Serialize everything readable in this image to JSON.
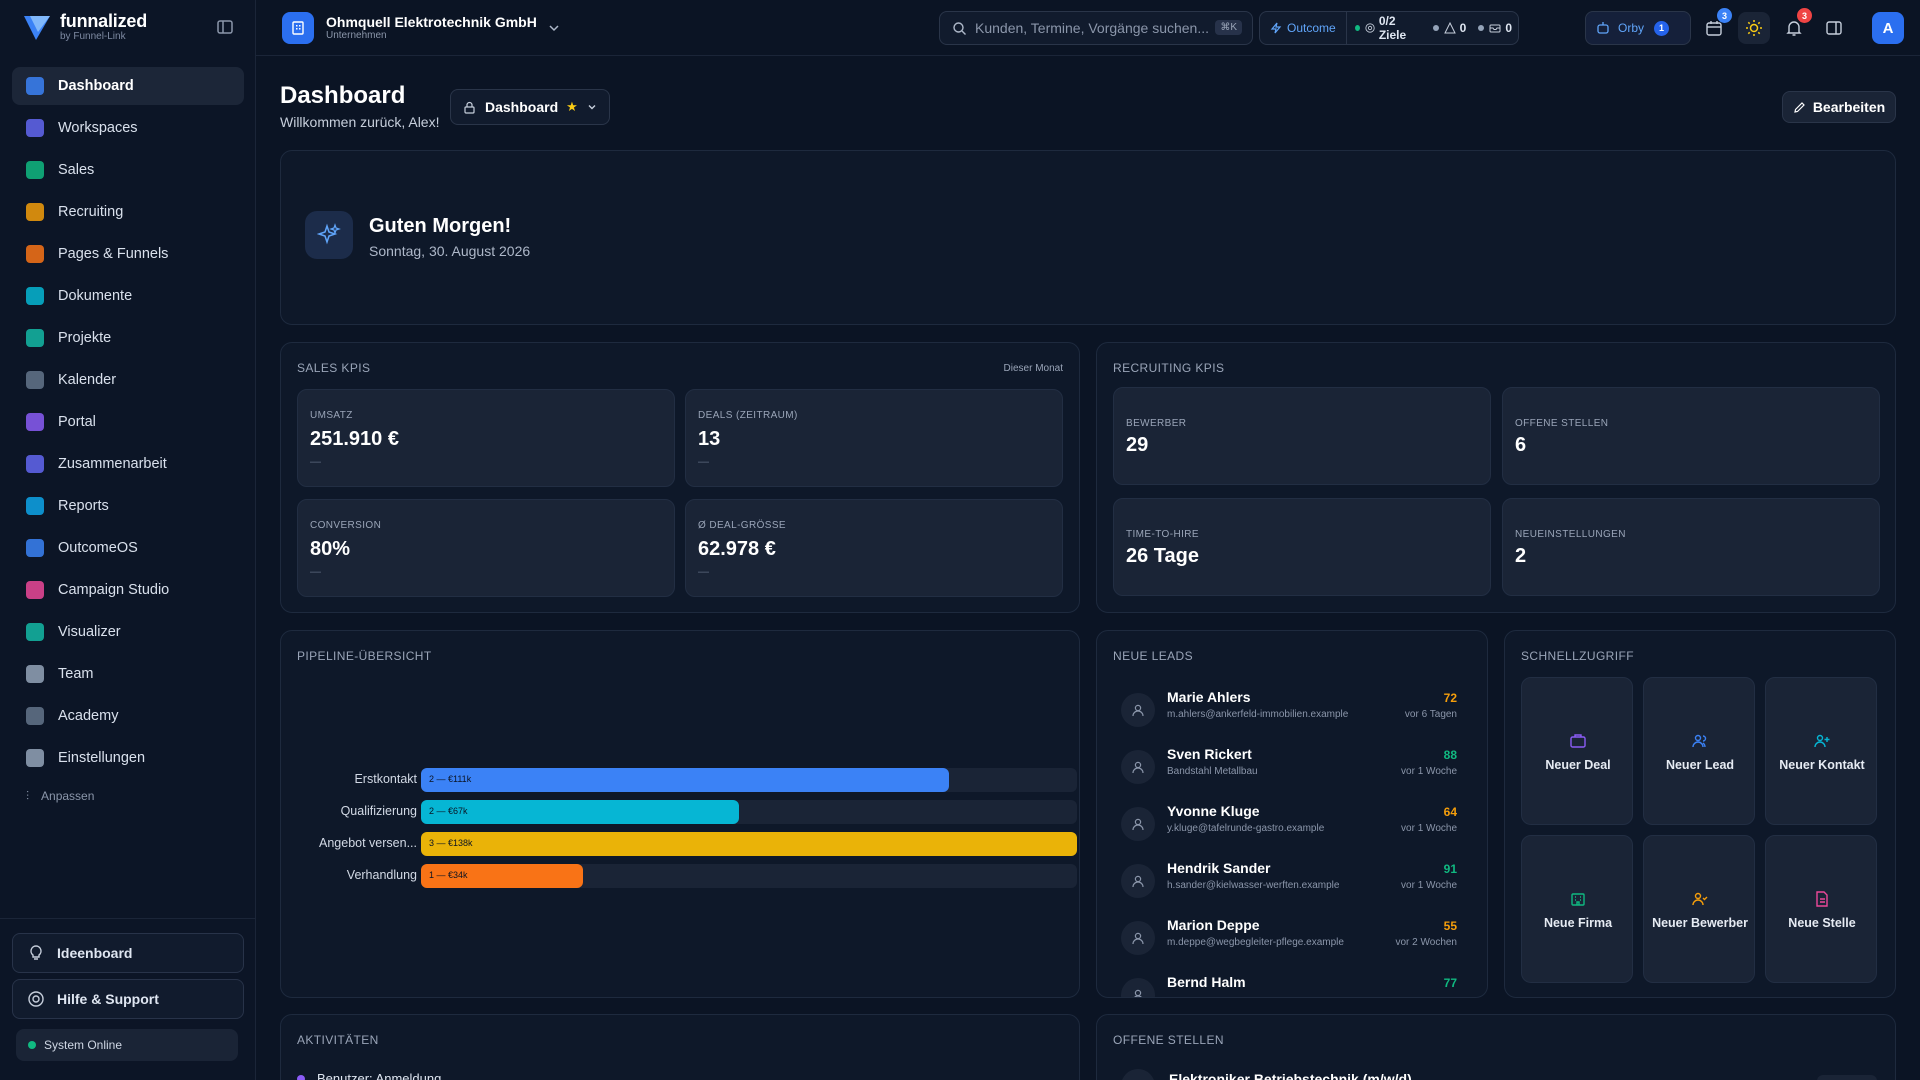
{
  "logo": {
    "name": "funnalized",
    "sub": "by Funnel-Link"
  },
  "sidebar": {
    "items": [
      {
        "label": "Dashboard",
        "color": "#3b82f6",
        "active": true
      },
      {
        "label": "Workspaces",
        "color": "#6366f1"
      },
      {
        "label": "Sales",
        "color": "#10b981"
      },
      {
        "label": "Recruiting",
        "color": "#f59e0b"
      },
      {
        "label": "Pages & Funnels",
        "color": "#f97316"
      },
      {
        "label": "Dokumente",
        "color": "#06b6d4"
      },
      {
        "label": "Projekte",
        "color": "#14b8a6"
      },
      {
        "label": "Kalender",
        "color": "#64748b"
      },
      {
        "label": "Portal",
        "color": "#8b5cf6"
      },
      {
        "label": "Zusammenarbeit",
        "color": "#6366f1"
      },
      {
        "label": "Reports",
        "color": "#0ea5e9"
      },
      {
        "label": "OutcomeOS",
        "color": "#3b82f6"
      },
      {
        "label": "Campaign Studio",
        "color": "#ec4899"
      },
      {
        "label": "Visualizer",
        "color": "#14b8a6"
      },
      {
        "label": "Team",
        "color": "#94a3b8"
      },
      {
        "label": "Academy",
        "color": "#64748b"
      },
      {
        "label": "Einstellungen",
        "color": "#94a3b8"
      }
    ],
    "customize": "Anpassen",
    "ideaboard": "Ideenboard",
    "help": "Hilfe & Support",
    "status": "System Online"
  },
  "topbar": {
    "company": "Ohmquell Elektrotechnik GmbH",
    "company_sub": "Unternehmen",
    "search_placeholder": "Kunden, Termine, Vorgänge suchen...",
    "search_kbd": "⌘K",
    "outcome": "Outcome",
    "goals": "0/2 Ziele",
    "alerts": "0",
    "inbox": "0",
    "orby": "Orby",
    "orby_badge": "1",
    "calendar_badge": "3",
    "notif_badge": "3",
    "avatar": "A"
  },
  "page": {
    "title": "Dashboard",
    "subtitle": "Willkommen zurück, Alex!",
    "select": "Dashboard",
    "edit": "Bearbeiten"
  },
  "greeting": {
    "title": "Guten Morgen!",
    "date": "Sonntag, 30. August 2026"
  },
  "sales_kpis": {
    "title": "SALES KPIS",
    "period": "Dieser Monat",
    "items": [
      {
        "label": "UMSATZ",
        "value": "251.910 €",
        "sub": "—"
      },
      {
        "label": "DEALS (ZEITRAUM)",
        "value": "13",
        "sub": "—"
      },
      {
        "label": "CONVERSION",
        "value": "80%",
        "sub": "—"
      },
      {
        "label": "Ø DEAL-GRÖSSE",
        "value": "62.978 €",
        "sub": "—"
      }
    ]
  },
  "recruiting_kpis": {
    "title": "RECRUITING KPIS",
    "items": [
      {
        "label": "BEWERBER",
        "value": "29"
      },
      {
        "label": "OFFENE STELLEN",
        "value": "6"
      },
      {
        "label": "TIME-TO-HIRE",
        "value": "26 Tage"
      },
      {
        "label": "NEUEINSTELLUNGEN",
        "value": "2"
      }
    ]
  },
  "pipeline": {
    "title": "PIPELINE-ÜBERSICHT",
    "rows": [
      {
        "label": "Erstkontakt",
        "text": "2 — €111k",
        "value": 111,
        "color": "#3b82f6"
      },
      {
        "label": "Qualifizierung",
        "text": "2 — €67k",
        "value": 67,
        "color": "#06b6d4"
      },
      {
        "label": "Angebot versen...",
        "text": "3 — €138k",
        "value": 138,
        "color": "#eab308"
      },
      {
        "label": "Verhandlung",
        "text": "1 — €34k",
        "value": 34,
        "color": "#f97316"
      }
    ],
    "max": 138
  },
  "leads": {
    "title": "NEUE LEADS",
    "items": [
      {
        "name": "Marie Ahlers",
        "mail": "m.ahlers@ankerfeld-immobilien.example",
        "score": "72",
        "time": "vor 6 Tagen",
        "color": "#f59e0b"
      },
      {
        "name": "Sven Rickert",
        "mail": "Bandstahl Metallbau",
        "score": "88",
        "time": "vor 1 Woche",
        "color": "#10b981"
      },
      {
        "name": "Yvonne Kluge",
        "mail": "y.kluge@tafelrunde-gastro.example",
        "score": "64",
        "time": "vor 1 Woche",
        "color": "#f59e0b"
      },
      {
        "name": "Hendrik Sander",
        "mail": "h.sander@kielwasser-werften.example",
        "score": "91",
        "time": "vor 1 Woche",
        "color": "#10b981"
      },
      {
        "name": "Marion Deppe",
        "mail": "m.deppe@wegbegleiter-pflege.example",
        "score": "55",
        "time": "vor 2 Wochen",
        "color": "#f59e0b"
      },
      {
        "name": "Bernd Halm",
        "mail": "",
        "score": "77",
        "time": "",
        "color": "#10b981"
      }
    ]
  },
  "quick": {
    "title": "SCHNELLZUGRIFF",
    "items": [
      {
        "label": "Neuer Deal",
        "icon": "briefcase-icon",
        "color": "#8b5cf6"
      },
      {
        "label": "Neuer Lead",
        "icon": "users-icon",
        "color": "#3b82f6"
      },
      {
        "label": "Neuer Kontakt",
        "icon": "user-plus-icon",
        "color": "#06b6d4"
      },
      {
        "label": "Neue Firma",
        "icon": "building-icon",
        "color": "#10b981"
      },
      {
        "label": "Neuer Bewerber",
        "icon": "user-check-icon",
        "color": "#f59e0b"
      },
      {
        "label": "Neue Stelle",
        "icon": "document-icon",
        "color": "#ec4899"
      }
    ]
  },
  "activities": {
    "title": "AKTIVITÄTEN",
    "first": "Benutzer: Anmeldung"
  },
  "jobs": {
    "title": "OFFENE STELLEN",
    "first": "Elektroniker Betriebstechnik (m/w/d)"
  }
}
